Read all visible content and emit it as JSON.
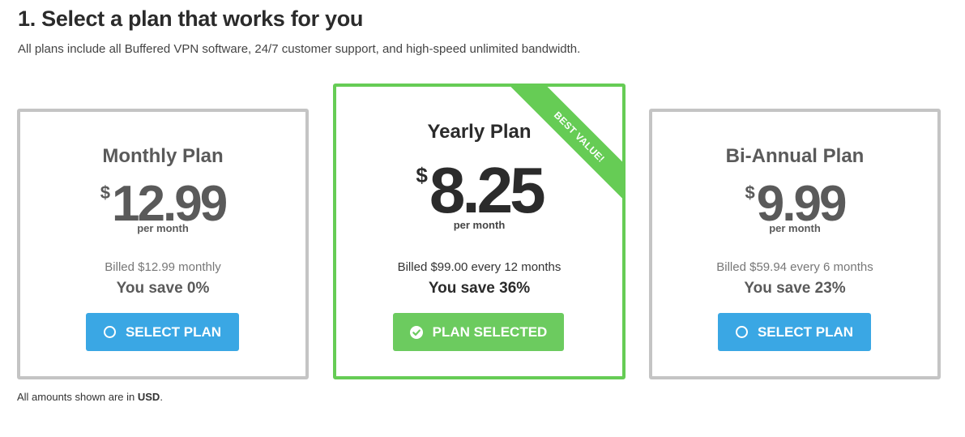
{
  "header": {
    "title": "1. Select a plan that works for you",
    "subtitle": "All plans include all Buffered VPN software, 24/7 customer support, and high-speed unlimited bandwidth."
  },
  "plans": [
    {
      "name": "Monthly Plan",
      "currency": "$",
      "amount": "12.99",
      "per": "per month",
      "billed": "Billed $12.99 monthly",
      "save": "You save 0%",
      "button": "SELECT PLAN",
      "button_icon": "radio-circle-icon",
      "selected": false
    },
    {
      "name": "Yearly Plan",
      "currency": "$",
      "amount": "8.25",
      "per": "per month",
      "billed": "Billed $99.00 every 12 months",
      "save": "You save 36%",
      "button": "PLAN SELECTED",
      "button_icon": "check-circle-icon",
      "selected": true,
      "badge": "BEST VALUE!"
    },
    {
      "name": "Bi-Annual Plan",
      "currency": "$",
      "amount": "9.99",
      "per": "per month",
      "billed": "Billed $59.94 every 6 months",
      "save": "You save 23%",
      "button": "SELECT PLAN",
      "button_icon": "radio-circle-icon",
      "selected": false
    }
  ],
  "footer": {
    "prefix": "All amounts shown are in ",
    "currency": "USD",
    "suffix": "."
  },
  "colors": {
    "select_button": "#3aa7e4",
    "selected_button": "#6ccb5f",
    "selected_border": "#66cc55",
    "card_border": "#c4c4c4"
  }
}
